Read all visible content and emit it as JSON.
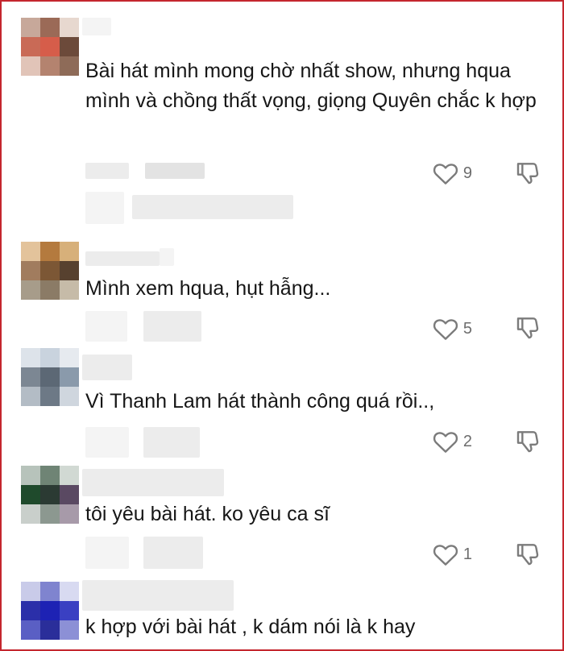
{
  "comments": [
    {
      "text": "Bài hát mình mong chờ nhất show, nhưng hqua mình và chồng thất vọng, giọng Quyên chắc k hợp",
      "likes": "9"
    },
    {
      "text": "Mình xem hqua, hụt hẫng...",
      "likes": "5"
    },
    {
      "text": "Vì Thanh Lam hát thành công quá rồi..,",
      "likes": "2"
    },
    {
      "text": "tôi yêu bài hát. ko yêu ca sĩ",
      "likes": "1"
    },
    {
      "text": "k hợp với bài hát , k dám nói là k hay",
      "likes": ""
    }
  ],
  "icons": {
    "like": "heart-outline-icon",
    "dislike": "thumbs-down-outline-icon"
  }
}
